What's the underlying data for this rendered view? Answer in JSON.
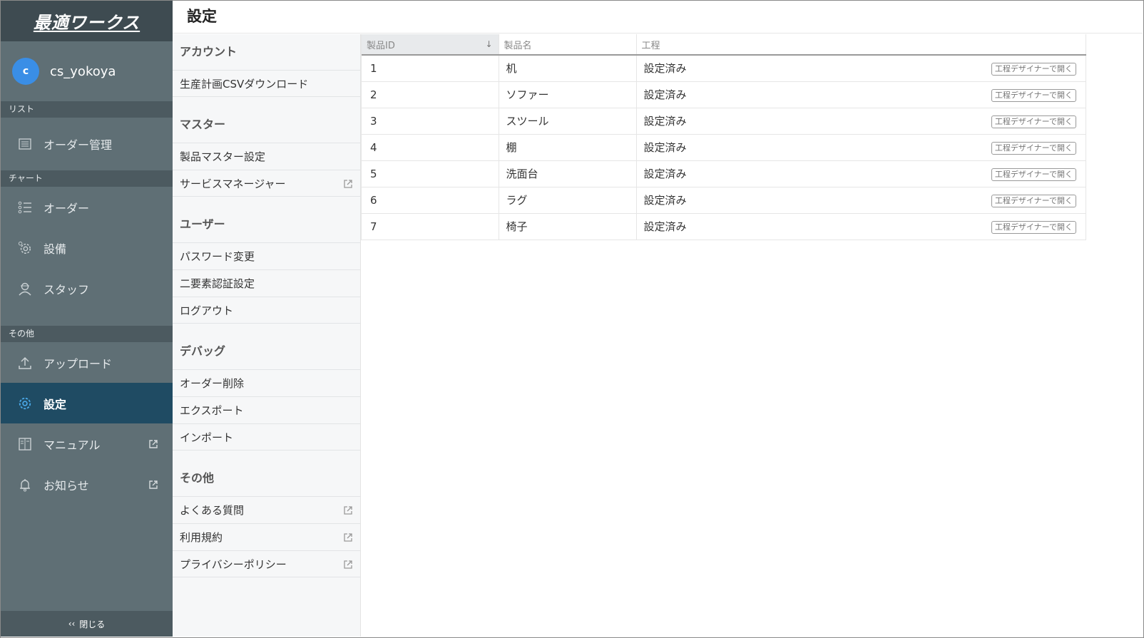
{
  "brand": {
    "logo_text": "最適ワークス"
  },
  "user": {
    "avatar_initial": "c",
    "name": "cs_yokoya"
  },
  "sidebar": {
    "sections": [
      {
        "label": "リスト",
        "items": [
          {
            "label": "オーダー管理",
            "icon": "list-icon"
          }
        ]
      },
      {
        "label": "チャート",
        "items": [
          {
            "label": "オーダー",
            "icon": "task-list-icon"
          },
          {
            "label": "設備",
            "icon": "gear-icon"
          },
          {
            "label": "スタッフ",
            "icon": "person-icon"
          }
        ]
      },
      {
        "label": "その他",
        "items": [
          {
            "label": "アップロード",
            "icon": "upload-icon"
          },
          {
            "label": "設定",
            "icon": "settings-icon",
            "active": true
          },
          {
            "label": "マニュアル",
            "icon": "book-icon",
            "external": true
          },
          {
            "label": "お知らせ",
            "icon": "bell-icon",
            "external": true
          }
        ]
      }
    ],
    "close_label": "閉じる",
    "close_arrows": "‹‹"
  },
  "header": {
    "title": "設定"
  },
  "settings_menu": {
    "groups": [
      {
        "title": "アカウント",
        "items": [
          {
            "label": "生産計画CSVダウンロード"
          }
        ]
      },
      {
        "title": "マスター",
        "items": [
          {
            "label": "製品マスター設定"
          },
          {
            "label": "サービスマネージャー",
            "external": true
          }
        ]
      },
      {
        "title": "ユーザー",
        "items": [
          {
            "label": "パスワード変更"
          },
          {
            "label": "二要素認証設定"
          },
          {
            "label": "ログアウト"
          }
        ]
      },
      {
        "title": "デバッグ",
        "items": [
          {
            "label": "オーダー削除"
          },
          {
            "label": "エクスポート"
          },
          {
            "label": "インポート"
          }
        ]
      },
      {
        "title": "その他",
        "items": [
          {
            "label": "よくある質問",
            "external": true
          },
          {
            "label": "利用規約",
            "external": true
          },
          {
            "label": "プライバシーポリシー",
            "external": true
          }
        ]
      }
    ]
  },
  "table": {
    "columns": [
      "製品ID",
      "製品名",
      "工程"
    ],
    "sort_indicator": "↓",
    "open_button_label": "工程デザイナーで開く",
    "rows": [
      {
        "id": "1",
        "name": "机",
        "status": "設定済み"
      },
      {
        "id": "2",
        "name": "ソファー",
        "status": "設定済み"
      },
      {
        "id": "3",
        "name": "スツール",
        "status": "設定済み"
      },
      {
        "id": "4",
        "name": "棚",
        "status": "設定済み"
      },
      {
        "id": "5",
        "name": "洗面台",
        "status": "設定済み"
      },
      {
        "id": "6",
        "name": "ラグ",
        "status": "設定済み"
      },
      {
        "id": "7",
        "name": "椅子",
        "status": "設定済み"
      }
    ]
  },
  "colors": {
    "sidebar_bg": "#5f6f75",
    "sidebar_active": "#1f4b63",
    "avatar": "#3a8ee6",
    "active_icon": "#4aa8e8"
  }
}
